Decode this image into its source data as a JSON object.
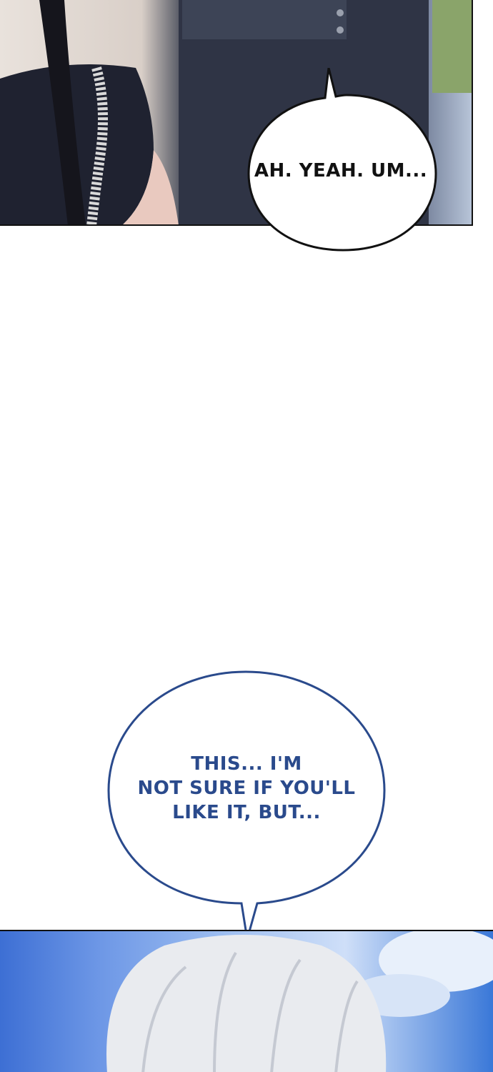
{
  "panels": {
    "top": {
      "speech_bubble": {
        "text": "AH. YEAH. UM..."
      }
    },
    "bottom": {
      "speech_bubble": {
        "lines": [
          "THIS... I'M",
          "NOT SURE IF YOU'LL",
          "LIKE IT, BUT..."
        ]
      }
    }
  },
  "colors": {
    "bubble_outline_black": "#111111",
    "bubble_outline_blue": "#2a4a8c",
    "text_blue": "#2a4a8c",
    "text_black": "#111111"
  }
}
